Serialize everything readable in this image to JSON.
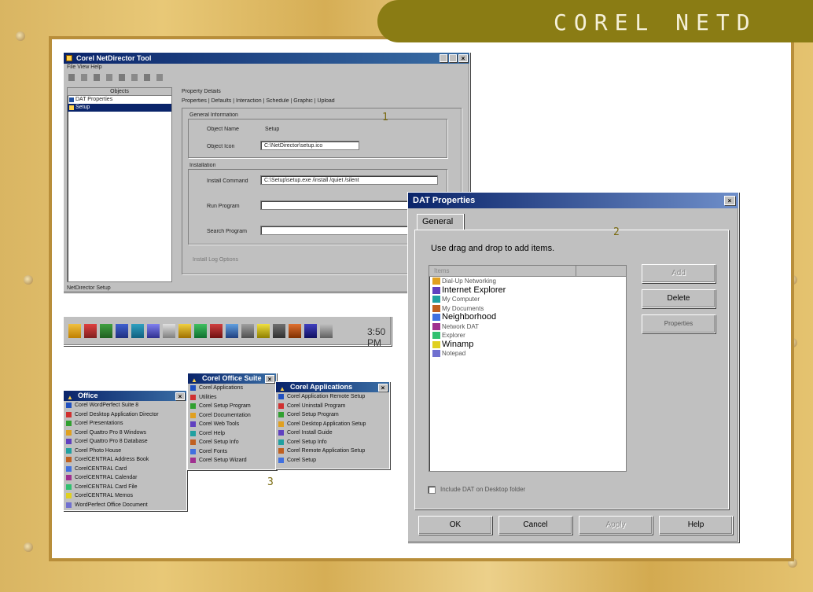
{
  "banner": {
    "title": "COREL NETD"
  },
  "callouts": [
    "1",
    "2",
    "3"
  ],
  "win1": {
    "title": "Corel NetDirector Tool",
    "menubar": "File  View  Help",
    "tree_header": "Objects",
    "tree_items": [
      "DAT Properties",
      "Setup"
    ],
    "breadcrumb": "Property Details",
    "tabs": "Properties | Defaults | Interaction | Schedule | Graphic | Upload",
    "section1": "General Information",
    "row1_label": "Object Name",
    "row1_value": "Setup",
    "row2_label": "Object Icon",
    "row2_value": "C:\\NetDirector\\setup.ico",
    "section2": "Installation",
    "row3_label": "Install Command",
    "row3_value": "C:\\Setup\\setup.exe /install /quiet /silent",
    "row4_label": "Run Program",
    "row5_label": "Search Program",
    "footer_label": "Install Log Options",
    "status": "NetDirector Setup"
  },
  "toolbar": {
    "clock": "3:50 PM"
  },
  "menus": {
    "m1": {
      "title": "Office",
      "items": [
        "Corel WordPerfect Suite 8",
        "Corel Desktop Application Director",
        "Corel Presentations",
        "Corel Quattro Pro 8 Windows",
        "Corel Quattro Pro 8 Database",
        "Corel Photo House",
        "CorelCENTRAL Address Book",
        "CorelCENTRAL Card",
        "CorelCENTRAL Calendar",
        "CorelCENTRAL Card File",
        "CorelCENTRAL Memos",
        "WordPerfect Office Document"
      ]
    },
    "m2": {
      "title": "Corel Office Suite",
      "items": [
        "Corel Applications",
        "Utilities",
        "Corel Setup Program",
        "Corel Documentation",
        "Corel Web Tools",
        "Corel Help",
        "Corel Setup Info",
        "Corel Fonts",
        "Corel Setup Wizard"
      ]
    },
    "m3": {
      "title": "Corel Applications",
      "items": [
        "Corel Application Remote Setup",
        "Corel Uninstall Program",
        "Corel Setup Program",
        "Corel Desktop Application Setup",
        "Corel Install Guide",
        "Corel Setup Info",
        "Corel Remote Application Setup",
        "Corel Setup"
      ]
    }
  },
  "dialog": {
    "title": "DAT Properties",
    "tab": "General",
    "instruction": "Use drag and drop to add items.",
    "list_header": "Items",
    "items": [
      "Dial-Up Networking",
      "Internet Explorer",
      "My Computer",
      "My Documents",
      "Neighborhood",
      "Network DAT",
      "Explorer",
      "Winamp",
      "Notepad"
    ],
    "buttons": {
      "add": "Add",
      "delete": "Delete",
      "properties": "Properties"
    },
    "checkbox_label": "Include DAT on Desktop folder",
    "footer": {
      "ok": "OK",
      "cancel": "Cancel",
      "apply": "Apply",
      "help": "Help"
    }
  }
}
